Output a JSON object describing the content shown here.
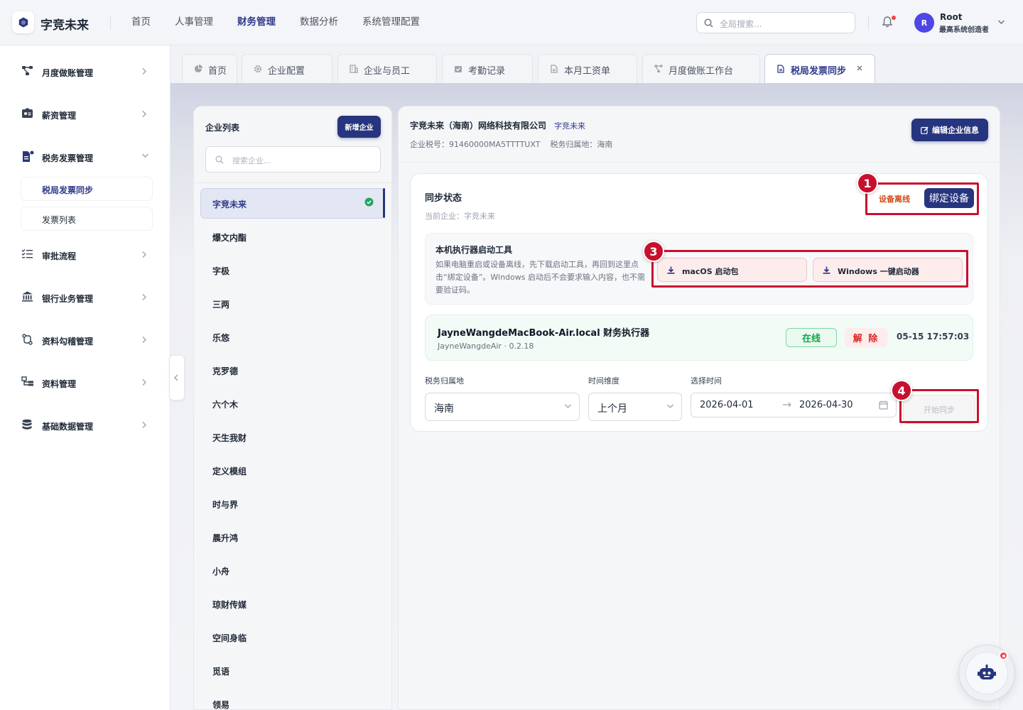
{
  "app": {
    "brand": "字竞未来"
  },
  "topnav": {
    "items": [
      {
        "label": "首页",
        "active": false
      },
      {
        "label": "人事管理",
        "active": false
      },
      {
        "label": "财务管理",
        "active": true
      },
      {
        "label": "数据分析",
        "active": false
      },
      {
        "label": "系统管理配置",
        "active": false
      }
    ]
  },
  "search": {
    "placeholder": "全局搜索..."
  },
  "user": {
    "initial": "R",
    "name": "Root",
    "role": "最高系统创造者"
  },
  "sidebar": {
    "items": [
      {
        "label": "月度做账管理",
        "icon": "flow-icon"
      },
      {
        "label": "薪资管理",
        "icon": "id-card-icon"
      },
      {
        "label": "税务发票管理",
        "icon": "invoice-icon",
        "expanded": true
      },
      {
        "label": "审批流程",
        "icon": "checklist-icon"
      },
      {
        "label": "银行业务管理",
        "icon": "bank-icon"
      },
      {
        "label": "资料勾稽管理",
        "icon": "link-icon"
      },
      {
        "label": "资料管理",
        "icon": "folder-tree-icon"
      },
      {
        "label": "基础数据管理",
        "icon": "database-icon"
      }
    ],
    "sub_items": [
      {
        "label": "税局发票同步",
        "active": true
      },
      {
        "label": "发票列表",
        "active": false
      }
    ]
  },
  "tabs": [
    {
      "label": "首页",
      "icon": "pie-icon",
      "active": false
    },
    {
      "label": "企业配置",
      "icon": "gear-icon",
      "active": false
    },
    {
      "label": "企业与员工",
      "icon": "building-icon",
      "active": false
    },
    {
      "label": "考勤记录",
      "icon": "calendar-check-icon",
      "active": false
    },
    {
      "label": "本月工资单",
      "icon": "doc-icon",
      "active": false
    },
    {
      "label": "月度做账工作台",
      "icon": "flow-icon",
      "active": false
    },
    {
      "label": "税局发票同步",
      "icon": "doc-icon",
      "active": true
    }
  ],
  "company_list": {
    "title": "企业列表",
    "new_button": "新增企业",
    "search_placeholder": "搜索企业...",
    "selected": "字竞未来",
    "items": [
      "爆文内酯",
      "字极",
      "三两",
      "乐悠",
      "克罗德",
      "六个木",
      "天生我财",
      "定义模组",
      "时与界",
      "晨升鸿",
      "小舟",
      "琼财传媒",
      "空间身临",
      "觅语",
      "领易"
    ]
  },
  "company": {
    "name": "字竞未来（海南）网络科技有限公司",
    "short_tag": "字竞未来",
    "tax_info": "企业税号：91460000MA5TTTTUXT    税务归属地：海南",
    "edit_button": "编辑企业信息"
  },
  "sync": {
    "title": "同步状态",
    "subtitle": "当前企业：字竞未来",
    "device_status": "设备离线",
    "bind_button": "绑定设备",
    "tool": {
      "title": "本机执行器启动工具",
      "desc": "如果电脑重启或设备离线，先下载启动工具，再回到这里点击“绑定设备”。Windows 启动后不会要求输入内容，也不需要验证码。",
      "mac_button": "macOS 启动包",
      "win_button": "Windows 一键启动器"
    },
    "executor": {
      "name": "JayneWangdeMacBook-Air.local 财务执行器",
      "host": "JayneWangdeAir · 0.2.18",
      "status": "在线",
      "unbind": "解 除",
      "time": "05-15 17:57:03"
    },
    "form": {
      "region_label": "税务归属地",
      "region_value": "海南",
      "period_label": "时间维度",
      "period_value": "上个月",
      "time_label": "选择时间",
      "start_date": "2026-04-01",
      "end_date": "2026-04-30",
      "start_button": "开始同步"
    }
  },
  "annotations": [
    "1",
    "3",
    "4"
  ],
  "colors": {
    "primary": "#27357e",
    "highlight": "#c8102e",
    "online": "#16a34a",
    "danger": "#dc2626"
  }
}
